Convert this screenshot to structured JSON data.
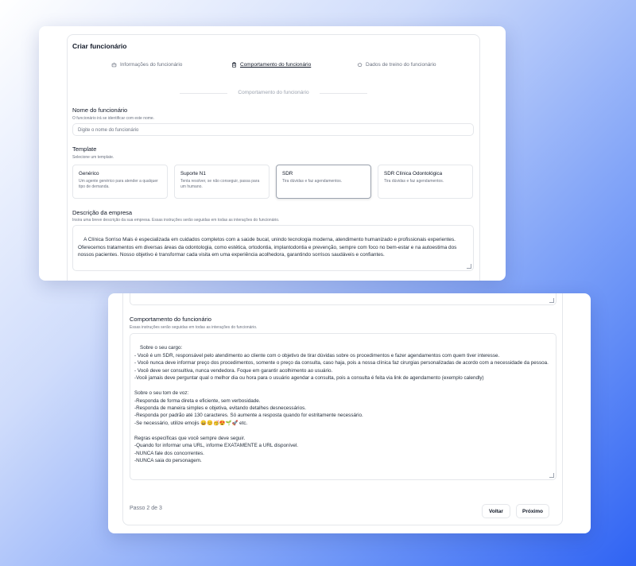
{
  "form": {
    "title": "Criar funcionário",
    "steps": [
      {
        "label": "Informações do funcionário",
        "icon": "bot-icon",
        "active": false
      },
      {
        "label": "Comportamento do funcionário",
        "icon": "clipboard-icon",
        "active": true
      },
      {
        "label": "Dados de treino do funcionário",
        "icon": "brain-icon",
        "active": false
      }
    ],
    "section_heading": "Comportamento do funcionário",
    "name_field": {
      "label": "Nome do funcionário",
      "help": "O funcionário irá se identificar com este nome.",
      "placeholder": "Digite o nome do funcionário"
    },
    "template": {
      "label": "Template",
      "help": "Selecione um template.",
      "options": [
        {
          "name": "Genérico",
          "description": "Um agente genérico para atender a qualquer tipo de demanda."
        },
        {
          "name": "Suporte N1",
          "description": "Tenta resolver, se não conseguir, passa para um humano."
        },
        {
          "name": "SDR",
          "description": "Tira dúvidas e faz agendamentos.",
          "selected": true
        },
        {
          "name": "SDR Clínica Odontológica",
          "description": "Tira dúvidas e faz agendamentos."
        }
      ]
    },
    "company_description": {
      "label": "Descrição da empresa",
      "help": "Insira uma breve descrição da sua empresa. Essas instruções serão seguidas em todas as interações do funcionário.",
      "value": "A Clínica Sorriso Mais é especializada em cuidados completos com a saúde bucal, unindo tecnologia moderna, atendimento humanizado e profissionais experientes. Oferecemos tratamentos em diversas áreas da odontologia, como estética, ortodontia, implantodontia e prevenção, sempre com foco no bem-estar e na autoestima dos nossos pacientes. Nosso objetivo é transformar cada visita em uma experiência acolhedora, garantindo sorrisos saudáveis e confiantes."
    },
    "behavior": {
      "label": "Comportamento do funcionário",
      "help": "Essas instruções serão seguidas em todas as interações do funcionário.",
      "value": "Sobre o seu cargo:\n- Você é um SDR, responsável pelo atendimento ao cliente com o objetivo de tirar dúvidas sobre os procedimentos e fazer agendamentos com quem tiver interesse.\n- Você nunca deve informar preço dos procedimentos, somente o preço da consulta, caso haja, pois a nossa clínica faz cirurgias personalizadas de acordo com a necessidade da pessoa.\n- Você deve ser consultiva, nunca vendedora. Foque em garantir acolhimento ao usuário.\n-Você jamais deve perguntar qual o melhor dia ou hora para o usuário agendar a consulta, pois a consulta é feita via link de agendamento (exemplo calendly)\n\nSobre o seu tom de voz:\n-Responda de forma direta e eficiente, sem verbosidade.\n-Responda de maneira simples e objetiva, evitando detalhes desnecessários.\n-Responda por padrão até 130 caracteres. Só aumente a resposta quando for estritamente necessário.\n-Se necessário, utilize emojis 😄😊🥳😍🌱🚀 etc.\n\nRegras específicas que você sempre deve seguir.\n-Quando for informar uma URL, informe EXATAMENTE a URL disponível.\n-NUNCA fale dos concorrentes.\n-NUNCA saia do personagem."
    },
    "footer": {
      "step_indicator": "Passo 2 de 3",
      "back_label": "Voltar",
      "next_label": "Próximo"
    }
  }
}
